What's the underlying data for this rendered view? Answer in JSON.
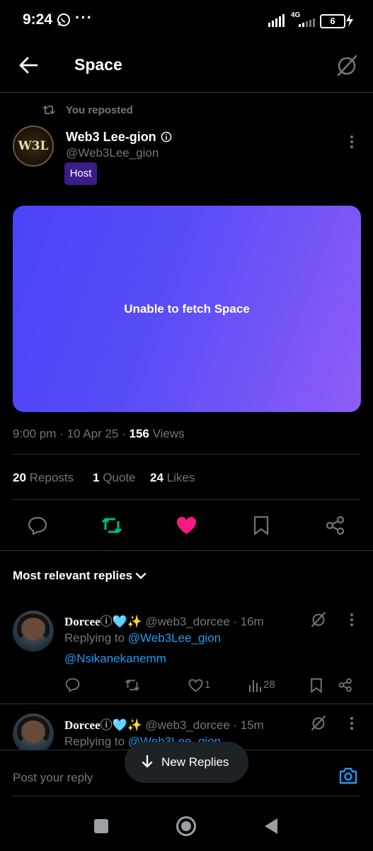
{
  "status": {
    "time": "9:24",
    "overflow": "···",
    "network": "4G",
    "battery": "6"
  },
  "header": {
    "title": "Space"
  },
  "repost_note": "You reposted",
  "author": {
    "name": "Web3 Lee-gion",
    "handle": "@Web3Lee_gion",
    "badge": "Host",
    "avatar_text": "W3L"
  },
  "space_card": {
    "message": "Unable to fetch Space"
  },
  "meta": {
    "time": "9:00 pm",
    "date": "10 Apr 25",
    "views_count": "156",
    "views_label": "Views",
    "sep": "·"
  },
  "stats": {
    "reposts_count": "20",
    "reposts_label": "Reposts",
    "quote_count": "1",
    "quote_label": "Quote",
    "likes_count": "24",
    "likes_label": "Likes"
  },
  "replies_section": {
    "title": "Most relevant replies"
  },
  "replies": [
    {
      "name": "Dorcee",
      "emoji": "ⓘ🩵✨",
      "handle": "@web3_dorcee",
      "time": "· 16m",
      "replying_to": "Replying to",
      "mention1": "@Web3Lee_gion",
      "mention2": "@Nsikanekanemm",
      "like_count": "1",
      "view_count": "28"
    },
    {
      "name": "Dorcee",
      "emoji": "ⓘ🩵✨",
      "handle": "@web3_dorcee",
      "time": "· 15m",
      "replying_to": "Replying to",
      "mention1": "@Web3Lee_gion"
    }
  ],
  "new_replies": {
    "label": "New Replies"
  },
  "composer": {
    "placeholder": "Post your reply"
  },
  "colors": {
    "accent": "#1d9bf0",
    "repost_green": "#00ba7c",
    "like_pink": "#f91880",
    "host_badge": "#3a1d87"
  }
}
